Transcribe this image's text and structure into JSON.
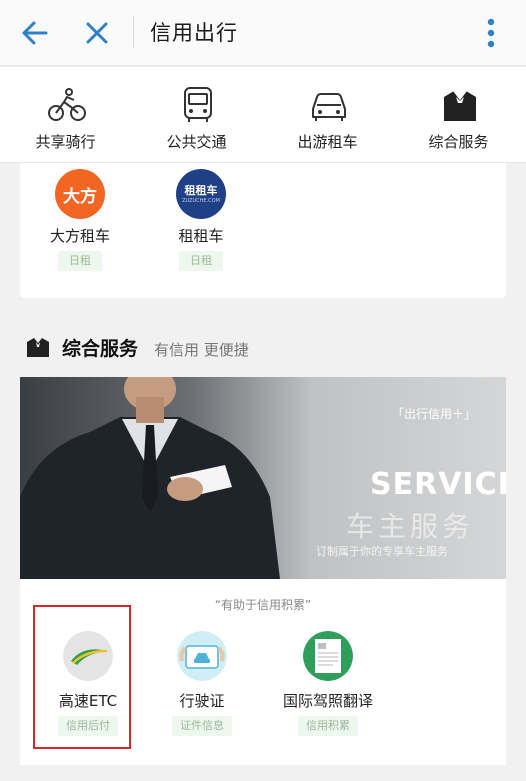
{
  "header": {
    "title": "信用出行"
  },
  "categories": [
    {
      "label": "共享骑行",
      "icon": "bike-icon"
    },
    {
      "label": "公共交通",
      "icon": "bus-icon"
    },
    {
      "label": "出游租车",
      "icon": "car-icon"
    },
    {
      "label": "综合服务",
      "icon": "suit-icon"
    }
  ],
  "rental": [
    {
      "name": "大方租车",
      "logo_text": "大方",
      "tag": "日租",
      "logo_color": "#f26522"
    },
    {
      "name": "租租车",
      "logo_text": "租租车",
      "logo_sub": "ZUZUCHE.COM",
      "tag": "日租",
      "logo_color": "#1f3f86"
    }
  ],
  "section": {
    "title": "综合服务",
    "subtitle": "有信用 更便捷"
  },
  "banner": {
    "tag": "「出行信用＋」",
    "title_en": "SERVICE",
    "title_cn": "车主服务",
    "subtitle": "订制属于你的专享车主服务"
  },
  "hint": "“有助于信用积累”",
  "services": [
    {
      "name": "高速ETC",
      "tag": "信用后付",
      "icon": "etc-road-icon"
    },
    {
      "name": "行驶证",
      "tag": "证件信息",
      "icon": "license-icon"
    },
    {
      "name": "国际驾照翻译",
      "tag": "信用积累",
      "icon": "intl-license-icon"
    }
  ],
  "colors": {
    "accent_blue": "#2f80c8",
    "tag_green": "#9ab89a",
    "highlight_red": "#d8262e"
  }
}
